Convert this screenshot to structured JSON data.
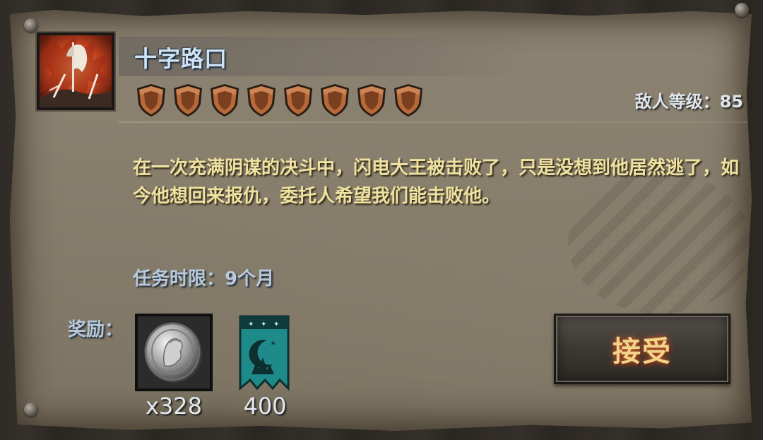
{
  "quest": {
    "title": "十字路口",
    "icon": "flag-battlefield-icon",
    "difficulty_shields": 8,
    "enemy_level_label": "敌人等级：85",
    "description": "在一次充满阴谋的决斗中，闪电大王被击败了，只是没想到他居然逃了，如今他想回来报仇，委托人希望我们能击败他。",
    "time_limit": "任务时限：9个月"
  },
  "rewards": {
    "label": "奖励：",
    "items": [
      {
        "icon": "silver-coin-icon",
        "count": "x328"
      },
      {
        "icon": "teal-banner-icon",
        "count": "400"
      }
    ]
  },
  "actions": {
    "accept_label": "接受"
  },
  "colors": {
    "title": "#cfe3f6",
    "description": "#efe2a0",
    "accept_text": "#f0d48a",
    "shield": "#b8693a",
    "banner": "#1f8a8a"
  }
}
